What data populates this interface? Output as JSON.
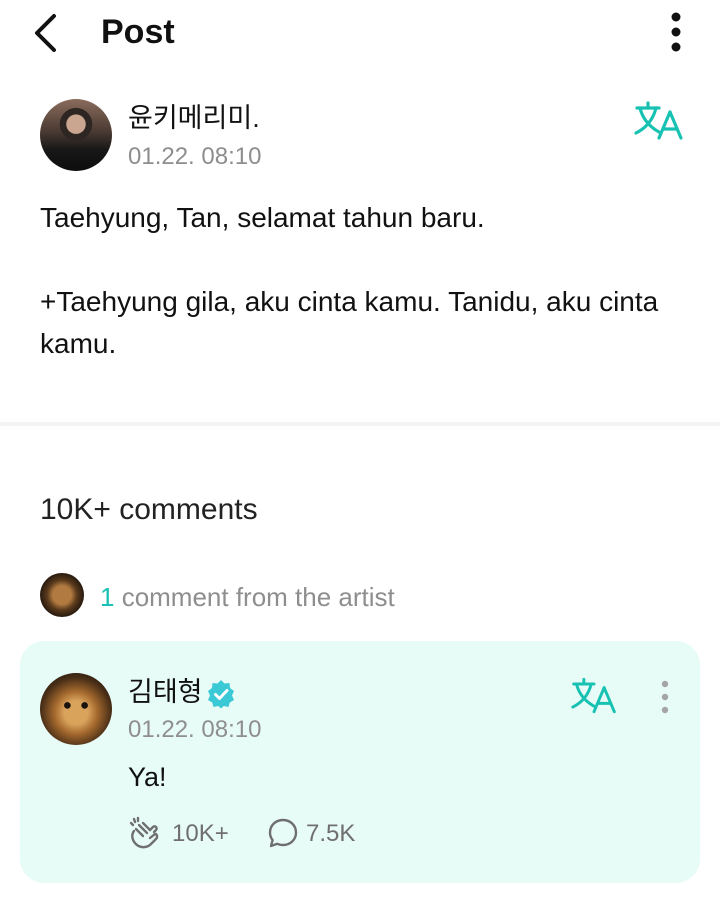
{
  "header": {
    "title": "Post",
    "back_icon": "chevron-left-icon",
    "menu_icon": "more-vertical-icon"
  },
  "post": {
    "author": "윤키메리미.",
    "timestamp": "01.22. 08:10",
    "translate_icon": "translate-icon",
    "body_line1": "Taehyung, Tan, selamat tahun baru.",
    "body_line2": "+Taehyung gila, aku cinta kamu. Tanidu, aku cinta kamu."
  },
  "comments": {
    "count_label": "10K+ comments",
    "artist_comment_count": "1",
    "artist_comment_label": " comment from the artist"
  },
  "artist_comment": {
    "author": "김태형",
    "verified_icon": "verified-badge-icon",
    "timestamp": "01.22. 08:10",
    "text": "Ya!",
    "likes": "10K+",
    "replies": "7.5K"
  },
  "colors": {
    "accent": "#18c2b2",
    "card_background": "#e8fcf7",
    "muted_text": "#8e8e8e"
  }
}
